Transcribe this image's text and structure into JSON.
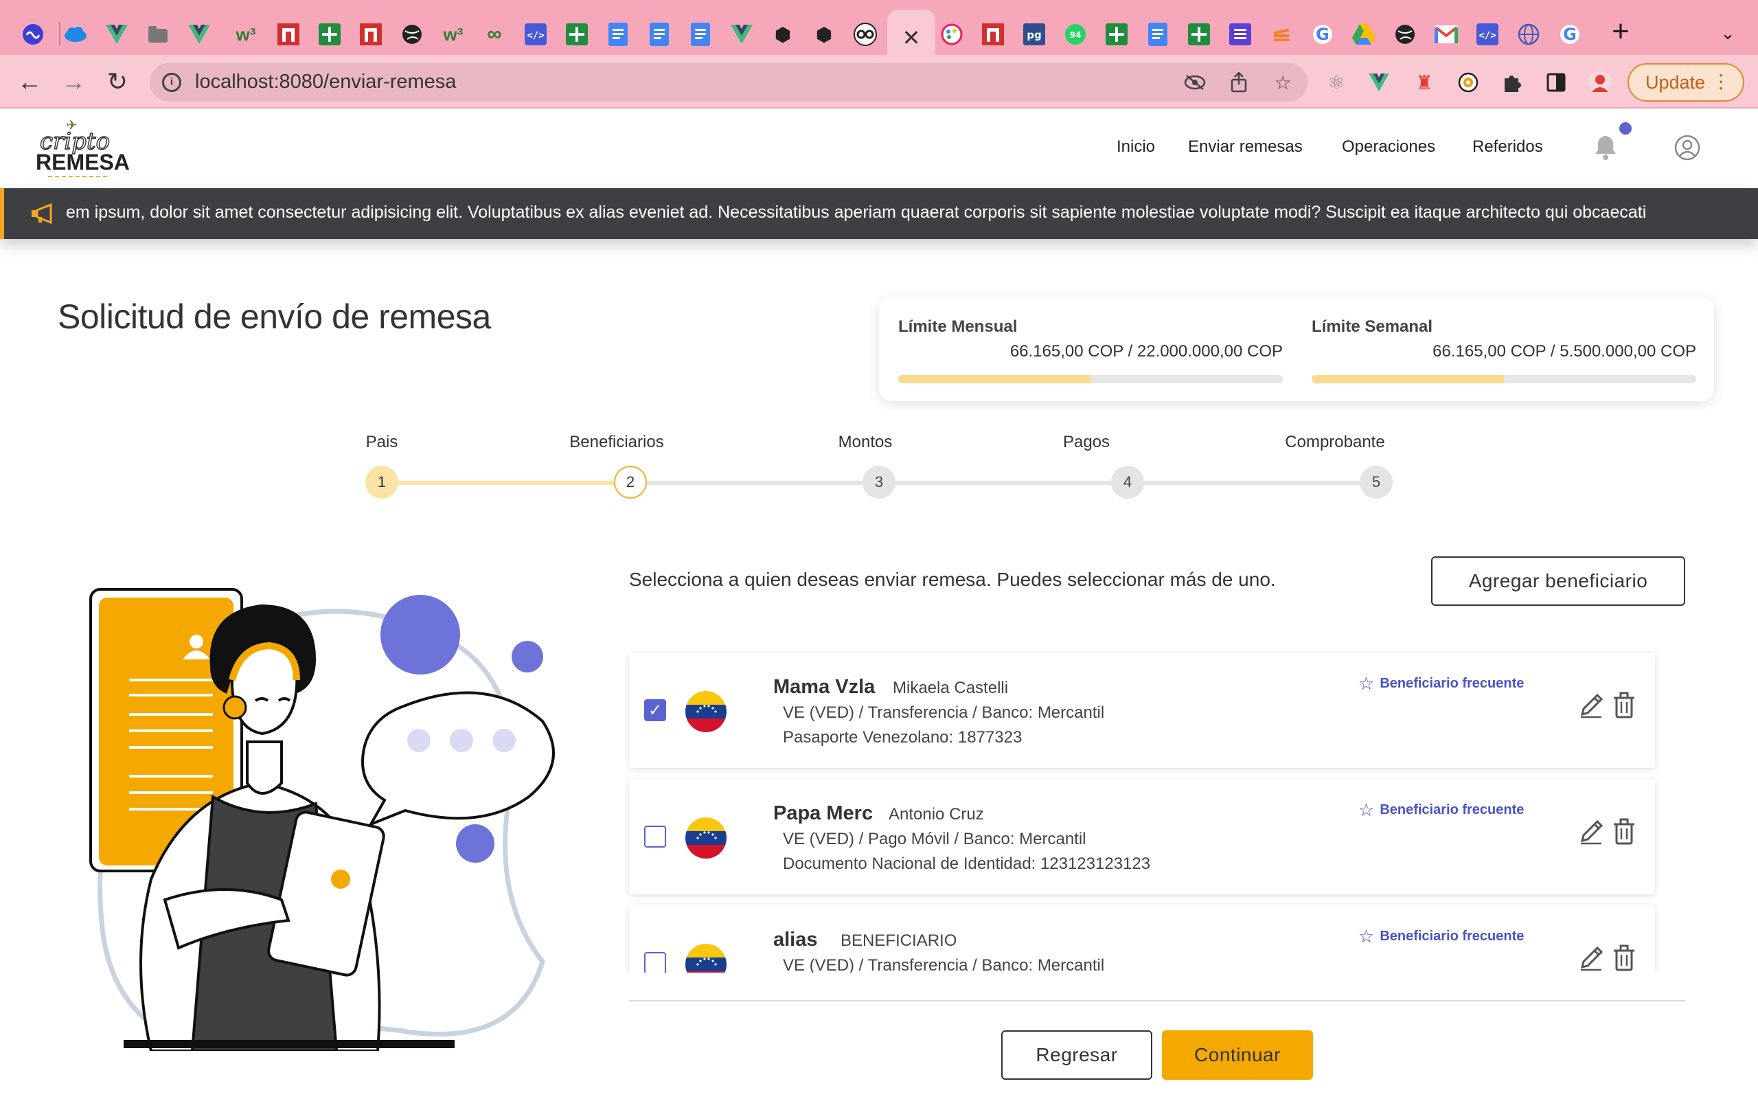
{
  "browser": {
    "url": "localhost:8080/enviar-remesa",
    "update_label": "Update",
    "tabs": [
      {
        "icon": "wave-icon",
        "color": "#3b3fd6"
      },
      {
        "icon": "cloud-icon",
        "color": "#1e88e5"
      },
      {
        "icon": "vue-icon",
        "color": "#41b883"
      },
      {
        "icon": "folder-icon",
        "color": "#666"
      },
      {
        "icon": "vue-icon",
        "color": "#41b883"
      },
      {
        "icon": "w3-icon",
        "color": "#2e7d32"
      },
      {
        "icon": "n-icon",
        "color": "#d32f2f"
      },
      {
        "icon": "plus-sheet-icon",
        "color": "#1e8e3e"
      },
      {
        "icon": "n-icon",
        "color": "#d32f2f"
      },
      {
        "icon": "globe-icon",
        "color": "#222"
      },
      {
        "icon": "w3-icon",
        "color": "#2e7d32"
      },
      {
        "icon": "infinity-icon",
        "color": "#2f7d32"
      },
      {
        "icon": "code-icon",
        "color": "#4659d8"
      },
      {
        "icon": "plus-sheet-icon",
        "color": "#1e8e3e"
      },
      {
        "icon": "doc-icon",
        "color": "#4285f4"
      },
      {
        "icon": "doc-icon",
        "color": "#4285f4"
      },
      {
        "icon": "doc-icon",
        "color": "#4285f4"
      },
      {
        "icon": "vue-icon",
        "color": "#41b883"
      },
      {
        "icon": "cube-icon",
        "color": "#222"
      },
      {
        "icon": "cube-icon",
        "color": "#222"
      },
      {
        "icon": "glasses-icon",
        "color": "#222"
      }
    ]
  },
  "header": {
    "logo_top": "cripto",
    "logo_bottom": "REMESA",
    "nav": [
      "Inicio",
      "Enviar remesas",
      "Operaciones",
      "Referidos"
    ]
  },
  "ticker": {
    "text": "em ipsum, dolor sit amet consectetur adipisicing elit. Voluptatibus ex alias eveniet ad. Necessitatibus aperiam quaerat corporis sit sapiente molestiae voluptate modi? Suscipit ea itaque architecto qui obcaecati"
  },
  "page": {
    "title": "Solicitud de envío de remesa"
  },
  "limits": {
    "monthly": {
      "label": "Límite Mensual",
      "value": "66.165,00 COP / 22.000.000,00 COP",
      "fill": 0.5
    },
    "weekly": {
      "label": "Límite Semanal",
      "value": "66.165,00 COP / 5.500.000,00 COP",
      "fill": 0.5
    }
  },
  "stepper": {
    "steps": [
      {
        "label": "Pais",
        "number": "1"
      },
      {
        "label": "Beneficiarios",
        "number": "2"
      },
      {
        "label": "Montos",
        "number": "3"
      },
      {
        "label": "Pagos",
        "number": "4"
      },
      {
        "label": "Comprobante",
        "number": "5"
      }
    ],
    "current": 2
  },
  "beneficiaries": {
    "instruction": "Selecciona a quien deseas enviar remesa. Puedes seleccionar más de uno.",
    "add_label": "Agregar beneficiario",
    "frequent_label": "Beneficiario frecuente",
    "items": [
      {
        "alias": "Mama Vzla",
        "name": "Mikaela Castelli",
        "line1": "VE (VED) / Transferencia / Banco: Mercantil",
        "line2": "Pasaporte Venezolano: 1877323",
        "checked": true
      },
      {
        "alias": "Papa Merc",
        "name": "Antonio Cruz",
        "line1": "VE (VED) / Pago Móvil / Banco: Mercantil",
        "line2": "Documento Nacional de Identidad: 123123123123",
        "checked": false
      },
      {
        "alias": "alias",
        "name": "BENEFICIARIO",
        "line1": "VE (VED) / Transferencia / Banco: Mercantil",
        "line2": "",
        "checked": false
      }
    ]
  },
  "actions": {
    "back_label": "Regresar",
    "next_label": "Continuar"
  },
  "colors": {
    "accent": "#f5a800",
    "brand_blue": "#5b63d3",
    "ticker_bg": "#3d3f42"
  }
}
